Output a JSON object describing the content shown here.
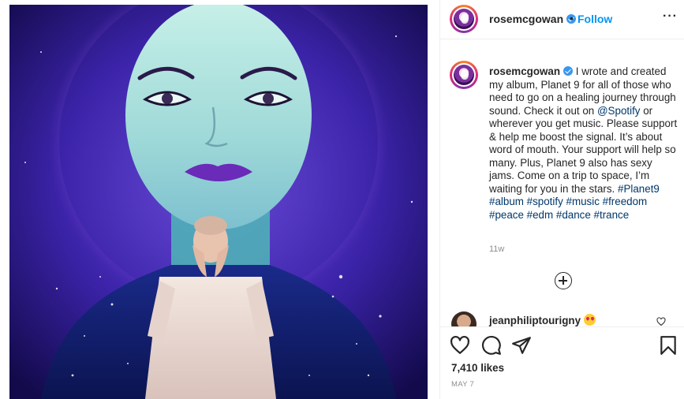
{
  "colors": {
    "accent": "#0095f6",
    "text": "#262626",
    "muted": "#8e8e8e",
    "link": "#00376b",
    "verified": "#3897f0"
  },
  "header": {
    "username": "rosemcgowan",
    "separator": "•",
    "follow_label": "Follow",
    "more_label": "···"
  },
  "caption": {
    "username": "rosemcgowan",
    "text_1": " I wrote and created my album, Planet 9 for all of those who need to go on a healing journey through sound. Check it out on ",
    "mention": "@Spotify",
    "text_2": " or wherever you get music. Please support & help me boost the signal. It’s about word of mouth. Your support will help so many. Plus, Planet 9 also has sexy jams. Come on a trip to space, I’m waiting for you in the stars. ",
    "hashtags": "#Planet9 #album #spotify #music #freedom #peace #edm #dance #trance",
    "time": "11w"
  },
  "comment": {
    "username": "jeanphiliptourigny",
    "emoji": "heart-eyes-emoji"
  },
  "actions": {
    "likes": "7,410 likes",
    "date": "MAY 7"
  },
  "icons": {
    "like": "heart-icon",
    "comment": "comment-bubble-icon",
    "share": "paper-plane-icon",
    "save": "bookmark-icon",
    "load_more": "plus-circle-icon"
  }
}
